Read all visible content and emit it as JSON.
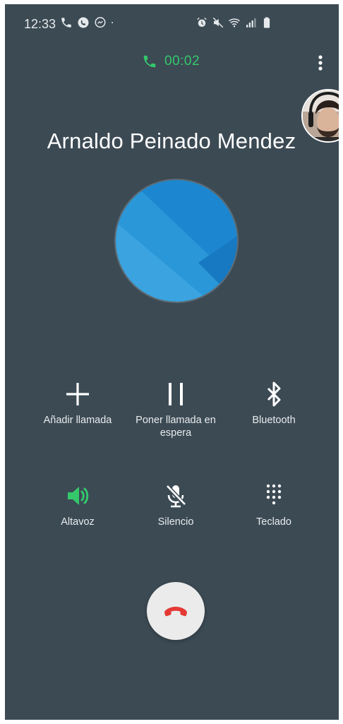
{
  "status_bar": {
    "time": "12:33",
    "left_icons": [
      "phone-icon",
      "whatsapp-icon",
      "messenger-icon",
      "dot-icon"
    ],
    "right_icons": [
      "alarm-icon",
      "mute-icon",
      "wifi-icon",
      "signal-icon",
      "battery-icon"
    ]
  },
  "call": {
    "duration": "00:02",
    "contact_name": "Arnaldo Peinado Mendez"
  },
  "actions_row1": [
    {
      "label": "Añadir llamada",
      "icon": "add-icon"
    },
    {
      "label": "Poner llamada en espera",
      "icon": "pause-icon"
    },
    {
      "label": "Bluetooth",
      "icon": "bluetooth-icon"
    }
  ],
  "actions_row2": [
    {
      "label": "Altavoz",
      "icon": "speaker-icon",
      "active": true
    },
    {
      "label": "Silencio",
      "icon": "mute-mic-icon"
    },
    {
      "label": "Teclado",
      "icon": "keypad-icon"
    }
  ],
  "end_call": {
    "icon": "end-call-icon"
  },
  "colors": {
    "background": "#3c4a54",
    "accent_green": "#34c86b",
    "end_call_red": "#e53935",
    "photo_blue": "#1e88d6"
  }
}
